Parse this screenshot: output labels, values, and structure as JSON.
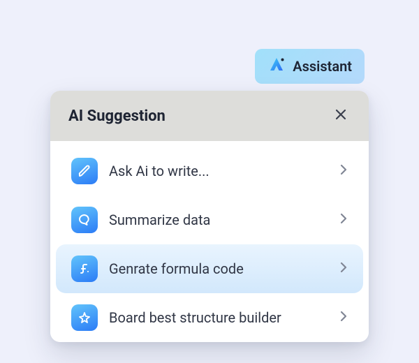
{
  "assistant_chip": {
    "label": "Assistant"
  },
  "panel": {
    "title": "AI Suggestion"
  },
  "items": [
    {
      "icon": "pencil-icon",
      "label": "Ask Ai  to write...",
      "highlighted": false
    },
    {
      "icon": "chat-icon",
      "label": "Summarize data",
      "highlighted": false
    },
    {
      "icon": "formula-icon",
      "label": "Genrate formula code",
      "highlighted": true
    },
    {
      "icon": "sparkle-icon",
      "label": "Board best structure builder",
      "highlighted": false
    }
  ]
}
